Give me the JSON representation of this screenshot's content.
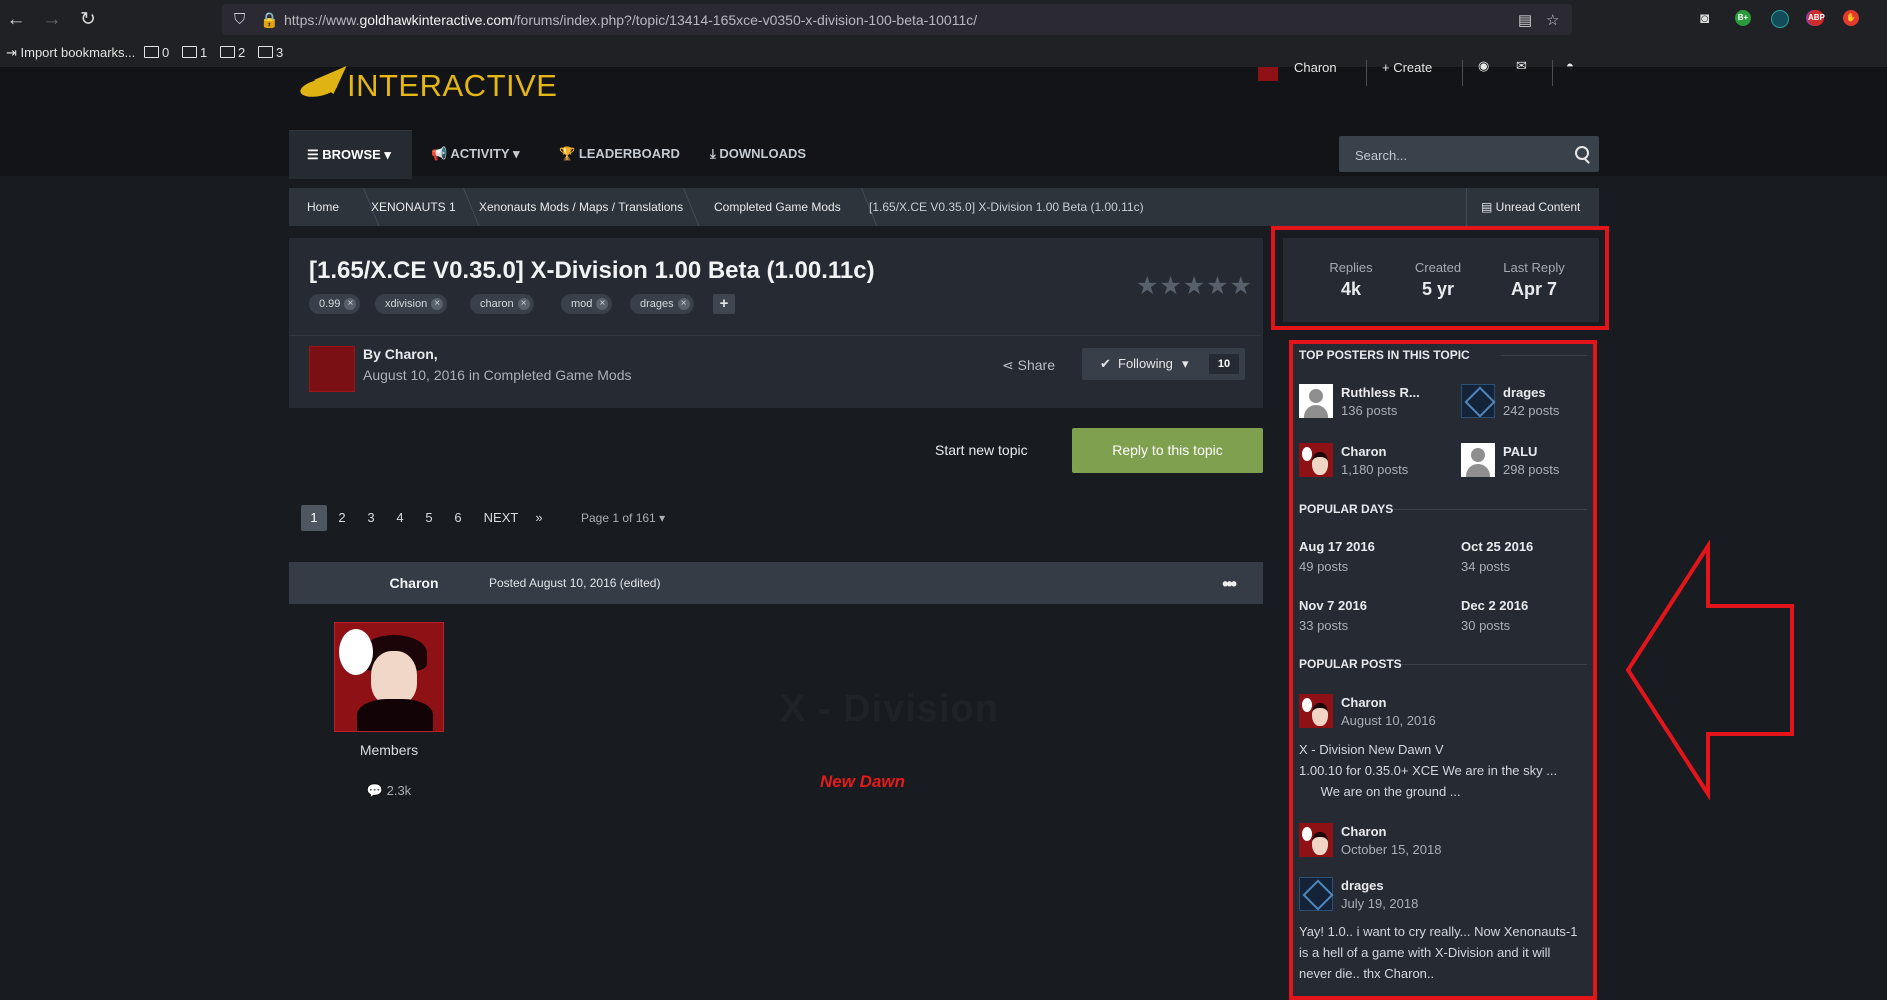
{
  "browser": {
    "url_prefix": "https://www.",
    "url_domain": "goldhawkinteractive.com",
    "url_path": "/forums/index.php?/topic/13414-165xce-v0350-x-division-100-beta-10011c/",
    "bookmarks": [
      "Import bookmarks...",
      "0",
      "1",
      "2",
      "3"
    ],
    "extensions": [
      "B+",
      "ABP"
    ]
  },
  "site": {
    "logo_text": "INTERACTIVE",
    "user_name": "Charon",
    "create_label": "Create",
    "nav": [
      {
        "label": "BROWSE",
        "icon": "list-icon"
      },
      {
        "label": "ACTIVITY",
        "icon": "megaphone-icon"
      },
      {
        "label": "LEADERBOARD",
        "icon": "trophy-icon"
      },
      {
        "label": "DOWNLOADS",
        "icon": "download-icon"
      }
    ],
    "search_placeholder": "Search..."
  },
  "breadcrumb": {
    "items": [
      "Home",
      "XENONAUTS 1",
      "Xenonauts Mods / Maps / Translations",
      "Completed Game Mods",
      "[1.65/X.CE V0.35.0] X-Division 1.00 Beta (1.00.11c)"
    ],
    "unread": "Unread Content"
  },
  "topic": {
    "title": "[1.65/X.CE V0.35.0] X-Division 1.00 Beta (1.00.11c)",
    "tags": [
      "0.99",
      "xdivision",
      "charon",
      "mod",
      "drages"
    ],
    "stars": "★★★★★",
    "by_label": "By Charon,",
    "date_line": "August 10, 2016 in Completed Game Mods",
    "share_label": "Share",
    "following_label": "Following",
    "followers_count": "10"
  },
  "actions": {
    "start_new": "Start new topic",
    "reply": "Reply to this topic"
  },
  "pagination": {
    "pages": [
      "1",
      "2",
      "3",
      "4",
      "5",
      "6"
    ],
    "next": "NEXT",
    "last": "»",
    "page_of": "Page 1 of 161"
  },
  "post": {
    "author": "Charon",
    "posted": "Posted August 10, 2016 (edited)",
    "more": "•••",
    "group": "Members",
    "count": "2.3k",
    "watermark": "X - Division",
    "subtitle": "New Dawn"
  },
  "stats": [
    {
      "label": "Replies",
      "value": "4k"
    },
    {
      "label": "Created",
      "value": "5 yr"
    },
    {
      "label": "Last Reply",
      "value": "Apr 7"
    }
  ],
  "sidebar": {
    "top_posters_title": "TOP POSTERS IN THIS TOPIC",
    "top_posters": [
      {
        "name": "Ruthless R...",
        "posts": "136 posts",
        "avatar": "default"
      },
      {
        "name": "drages",
        "posts": "242 posts",
        "avatar": "mech"
      },
      {
        "name": "Charon",
        "posts": "1,180 posts",
        "avatar": "red"
      },
      {
        "name": "PALU",
        "posts": "298 posts",
        "avatar": "default"
      }
    ],
    "popular_days_title": "POPULAR DAYS",
    "popular_days": [
      {
        "date": "Aug 17 2016",
        "posts": "49 posts"
      },
      {
        "date": "Oct 25 2016",
        "posts": "34 posts"
      },
      {
        "date": "Nov 7 2016",
        "posts": "33 posts"
      },
      {
        "date": "Dec 2 2016",
        "posts": "30 posts"
      }
    ],
    "popular_posts_title": "POPULAR POSTS",
    "popular_posts": [
      {
        "author": "Charon",
        "date": "August 10, 2016",
        "avatar": "red",
        "lines": [
          "X - Division   New Dawn V",
          "1.00.10 for 0.35.0+ XCE   We are in the sky ...",
          "      We are on the ground ..."
        ]
      },
      {
        "author": "Charon",
        "date": "October 15, 2018",
        "avatar": "red",
        "lines": []
      },
      {
        "author": "drages",
        "date": "July 19, 2018",
        "avatar": "mech",
        "lines": [
          "Yay! 1.0.. i want to cry really... Now Xenonauts-1",
          "is a hell of a game with X-Division and it will",
          "never die.. thx Charon.."
        ]
      }
    ]
  },
  "colors": {
    "accent_gold": "#e4b616",
    "reply_green": "#7fa04f",
    "highlight_red": "#e3151b"
  }
}
